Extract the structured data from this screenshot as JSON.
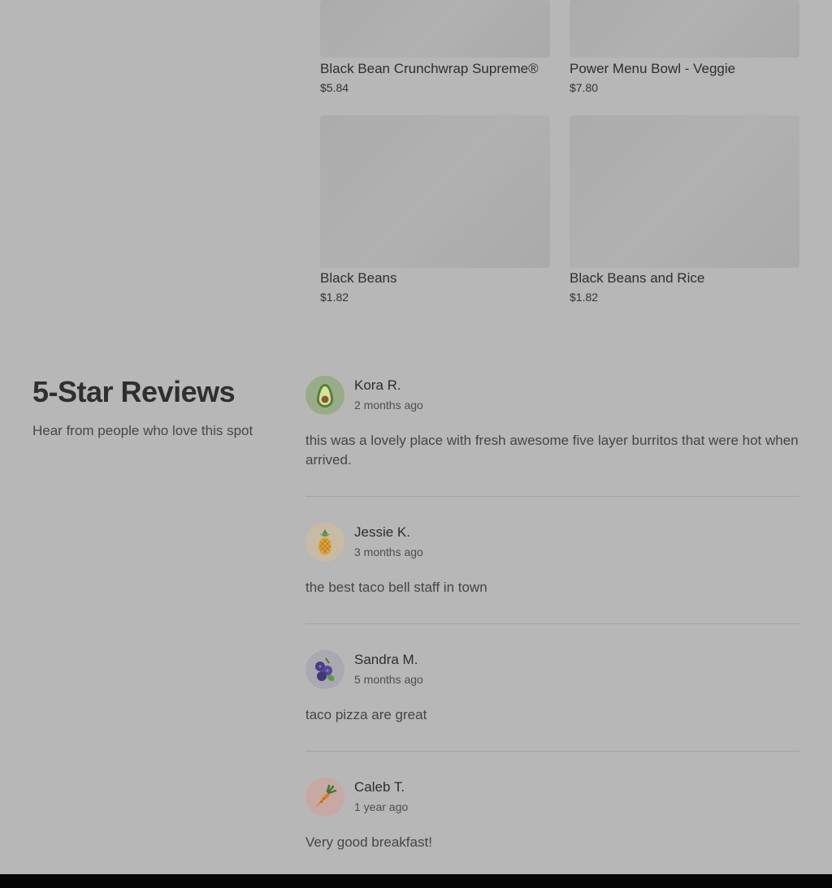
{
  "menu": {
    "items": [
      {
        "name": "Black Bean Crunchwrap Supreme®",
        "price": "$5.84"
      },
      {
        "name": "Power Menu Bowl - Veggie",
        "price": "$7.80"
      },
      {
        "name": "Black Beans",
        "price": "$1.82"
      },
      {
        "name": "Black Beans and Rice",
        "price": "$1.82"
      }
    ]
  },
  "reviews": {
    "title": "5-Star Reviews",
    "subtitle": "Hear from people who love this spot",
    "items": [
      {
        "name": "Kora R.",
        "time": "2 months ago",
        "text": "this was a lovely place with fresh awesome five layer burritos that were hot when arrived.",
        "avatar_icon": "avocado-icon",
        "avatar_color": "#9aab88"
      },
      {
        "name": "Jessie K.",
        "time": "3 months ago",
        "text": "the best taco bell staff in town",
        "avatar_icon": "pineapple-icon",
        "avatar_color": "#c7bba6"
      },
      {
        "name": "Sandra M.",
        "time": "5 months ago",
        "text": "taco pizza are great",
        "avatar_icon": "blueberry-icon",
        "avatar_color": "#a9a9b2"
      },
      {
        "name": "Caleb T.",
        "time": "1 year ago",
        "text": "Very good breakfast!",
        "avatar_icon": "carrot-icon",
        "avatar_color": "#c7a8a4"
      }
    ]
  }
}
